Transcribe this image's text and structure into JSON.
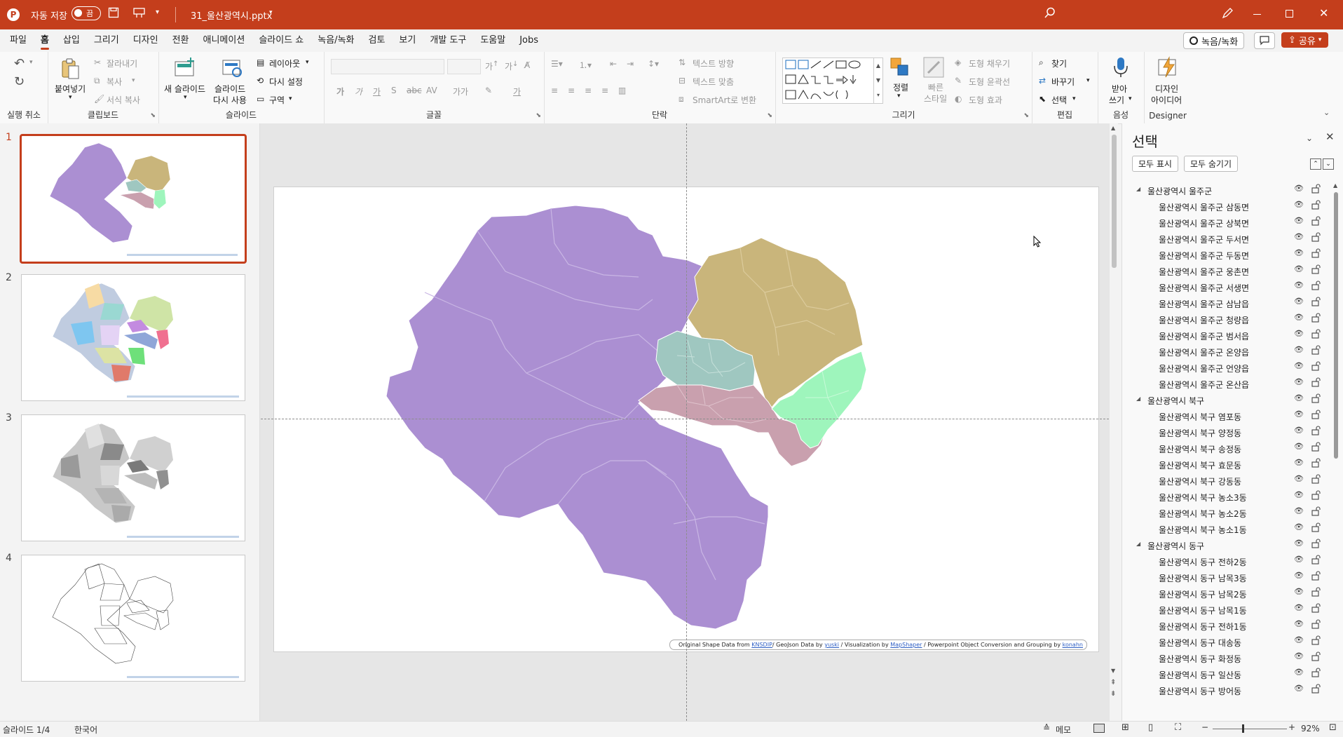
{
  "titlebar": {
    "autosave_label": "자동 저장",
    "autosave_state": "끔",
    "filename": "31_울산광역시.pptx",
    "controls": [
      "minimize",
      "restore",
      "close"
    ]
  },
  "menu": {
    "items": [
      "파일",
      "홈",
      "삽입",
      "그리기",
      "디자인",
      "전환",
      "애니메이션",
      "슬라이드 쇼",
      "녹음/녹화",
      "검토",
      "보기",
      "개발 도구",
      "도움말",
      "Jobs"
    ],
    "active": "홈",
    "record_label": "녹음/녹화",
    "share_label": "공유"
  },
  "ribbon": {
    "undo_group": "실행 취소",
    "clipboard": {
      "paste": "붙여넣기",
      "cut": "잘라내기",
      "copy": "복사",
      "format_painter": "서식 복사",
      "label": "클립보드"
    },
    "slides": {
      "new_slide": "새 슬라이드",
      "reuse_l1": "슬라이드",
      "reuse_l2": "다시 사용",
      "layout": "레이아웃",
      "reset": "다시 설정",
      "section": "구역",
      "label": "슬라이드"
    },
    "font": {
      "label": "글꼴"
    },
    "paragraph": {
      "text_dir": "텍스트 방향",
      "align_text": "텍스트 맞춤",
      "smartart": "SmartArt로 변환",
      "label": "단락"
    },
    "drawing": {
      "arrange": "정렬",
      "quick_l1": "빠른",
      "quick_l2": "스타일",
      "fill": "도형 채우기",
      "outline": "도형 윤곽선",
      "effects": "도형 효과",
      "label": "그리기"
    },
    "editing": {
      "find": "찾기",
      "replace": "바꾸기",
      "select": "선택",
      "label": "편집"
    },
    "voice": {
      "dictate_l1": "받아",
      "dictate_l2": "쓰기",
      "label": "음성"
    },
    "designer": {
      "ideas_l1": "디자인",
      "ideas_l2": "아이디어",
      "label": "Designer"
    }
  },
  "thumbnails": [
    {
      "number": "1",
      "style": "color-grouped",
      "selected": true
    },
    {
      "number": "2",
      "style": "multicolor",
      "selected": false
    },
    {
      "number": "3",
      "style": "grayscale",
      "selected": false
    },
    {
      "number": "4",
      "style": "outline",
      "selected": false
    }
  ],
  "slide": {
    "credit": {
      "t1": "Original Shape Data from ",
      "l1": "KNSDIP",
      "t2": "/ GeoJson Data by ",
      "l2": "yuski",
      "t3": " / Visualization  by ",
      "l3": "MapShaper",
      "t4": " / Powerpoint Object Conversion and Grouping  by ",
      "l4": "konahn"
    },
    "region_colors": {
      "ulju": "#ab8fd2",
      "buk": "#c9b57b",
      "jung": "#9fc7c0",
      "nam": "#c9a0ae",
      "dong": "#9ef5bc"
    }
  },
  "selection_pane": {
    "title": "선택",
    "show_all": "모두 표시",
    "hide_all": "모두 숨기기",
    "items": [
      {
        "label": "울산광역시 울주군",
        "group": true
      },
      {
        "label": "울산광역시 울주군 삼동면"
      },
      {
        "label": "울산광역시 울주군 상북면"
      },
      {
        "label": "울산광역시 울주군 두서면"
      },
      {
        "label": "울산광역시 울주군 두동면"
      },
      {
        "label": "울산광역시 울주군 웅촌면"
      },
      {
        "label": "울산광역시 울주군 서생면"
      },
      {
        "label": "울산광역시 울주군 삼남읍"
      },
      {
        "label": "울산광역시 울주군 청량읍"
      },
      {
        "label": "울산광역시 울주군 범서읍"
      },
      {
        "label": "울산광역시 울주군 온양읍"
      },
      {
        "label": "울산광역시 울주군 언양읍"
      },
      {
        "label": "울산광역시 울주군 온산읍"
      },
      {
        "label": "울산광역시 북구",
        "group": true
      },
      {
        "label": "울산광역시 북구 염포동"
      },
      {
        "label": "울산광역시 북구 양정동"
      },
      {
        "label": "울산광역시 북구 송정동"
      },
      {
        "label": "울산광역시 북구 효문동"
      },
      {
        "label": "울산광역시 북구 강동동"
      },
      {
        "label": "울산광역시 북구 농소3동"
      },
      {
        "label": "울산광역시 북구 농소2동"
      },
      {
        "label": "울산광역시 북구 농소1동"
      },
      {
        "label": "울산광역시 동구",
        "group": true
      },
      {
        "label": "울산광역시 동구 전하2동"
      },
      {
        "label": "울산광역시 동구 남목3동"
      },
      {
        "label": "울산광역시 동구 남목2동"
      },
      {
        "label": "울산광역시 동구 남목1동"
      },
      {
        "label": "울산광역시 동구 전하1동"
      },
      {
        "label": "울산광역시 동구 대송동"
      },
      {
        "label": "울산광역시 동구 화정동"
      },
      {
        "label": "울산광역시 동구 일산동"
      },
      {
        "label": "울산광역시 동구 방어동"
      }
    ]
  },
  "status": {
    "slide_count": "슬라이드 1/4",
    "language": "한국어",
    "notes": "메모",
    "zoom": "92%"
  }
}
